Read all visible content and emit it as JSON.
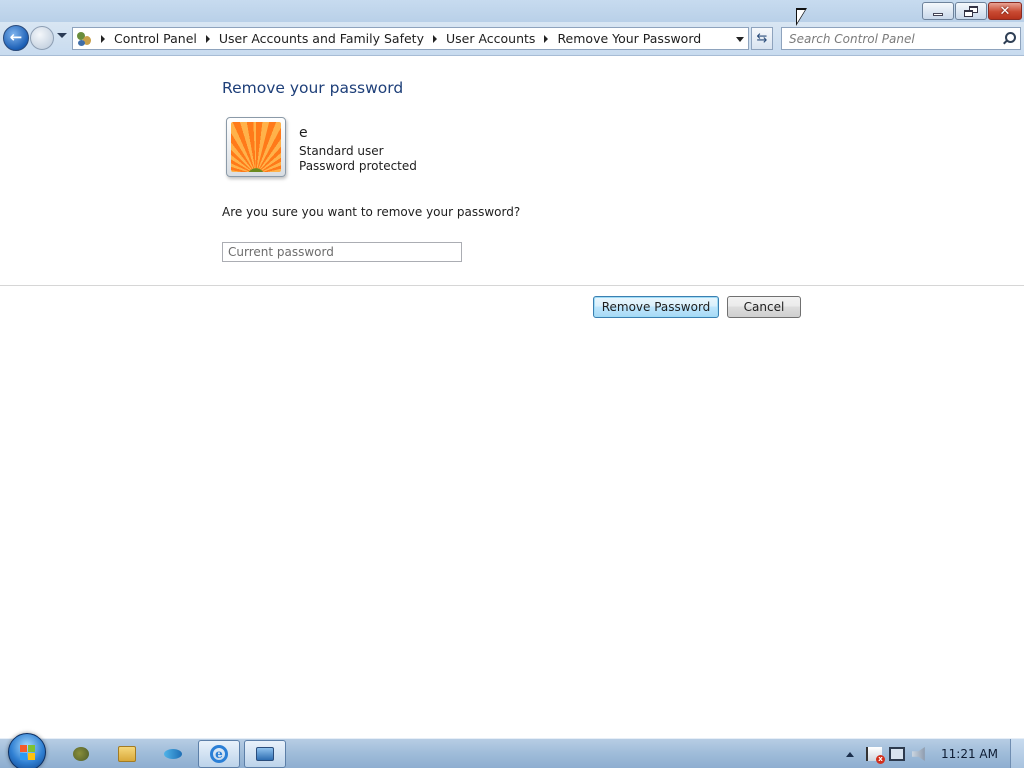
{
  "window": {
    "caption_buttons": [
      {
        "name": "minimize",
        "icon": "minimize-icon"
      },
      {
        "name": "restore",
        "icon": "restore-icon"
      },
      {
        "name": "close",
        "icon": "close-icon"
      }
    ]
  },
  "navigation": {
    "breadcrumbs": [
      "Control Panel",
      "User Accounts and Family Safety",
      "User Accounts",
      "Remove Your Password"
    ],
    "search_placeholder": "Search Control Panel"
  },
  "main": {
    "title": "Remove your password",
    "user": {
      "name": "e",
      "role": "Standard user",
      "status": "Password protected"
    },
    "question": "Are you sure you want to remove your password?",
    "password_placeholder": "Current password",
    "primary_button": "Remove Password",
    "cancel_button": "Cancel"
  },
  "taskbar": {
    "pinned": [
      {
        "name": "control-panel",
        "icon": "control-panel-icon"
      },
      {
        "name": "windows-explorer",
        "icon": "folder-icon"
      },
      {
        "name": "media-app",
        "icon": "fish-icon"
      },
      {
        "name": "internet-explorer",
        "icon": "ie-icon"
      },
      {
        "name": "control-panel-window",
        "icon": "window-icon"
      }
    ],
    "clock": "11:21 AM"
  },
  "colors": {
    "title_color": "#1e3f79",
    "primary_button_border": "#3c7fb1",
    "taskbar": "#9fbcd9"
  }
}
